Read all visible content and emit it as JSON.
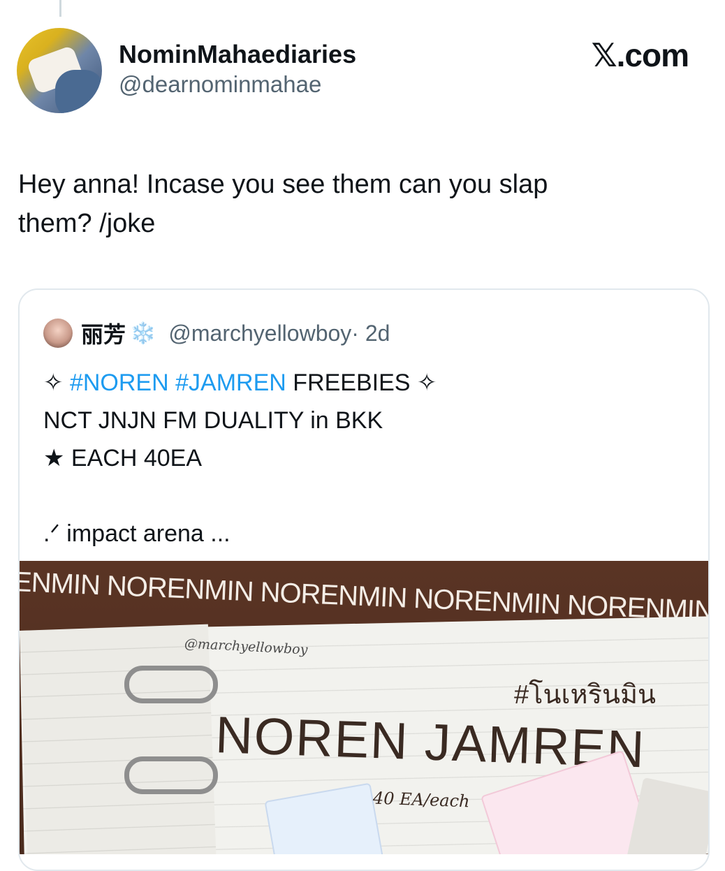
{
  "brand": {
    "label": "𝕏.com"
  },
  "tweet": {
    "display_name": "NominMahaediaries",
    "handle": "@dearnominmahae",
    "text_line1": "Hey anna! Incase you see them can you slap",
    "text_line2": "them? /joke"
  },
  "quote": {
    "display_name": "丽芳",
    "emoji": "❄️",
    "handle": "@marchyellowboy",
    "time": "· 2d",
    "line1": {
      "star_left": "✧",
      "tag1": "#NOREN",
      "tag2": "#JAMREN",
      "rest": "FREEBIES",
      "star_right": "✧"
    },
    "line2": "NCT JNJN FM DUALITY in BKK",
    "line3": "★ EACH 40EA",
    "line4": ".ᐟ impact arena ..."
  },
  "media": {
    "banner": "ENMIN NORENMIN NORENMIN NORENMIN NORENMIN NORENMI",
    "watermark": "@marchyellowboy",
    "thai_tag": "#โนเหรินมิน",
    "title": "NOREN JAMREN",
    "count": "40 EA/each"
  }
}
